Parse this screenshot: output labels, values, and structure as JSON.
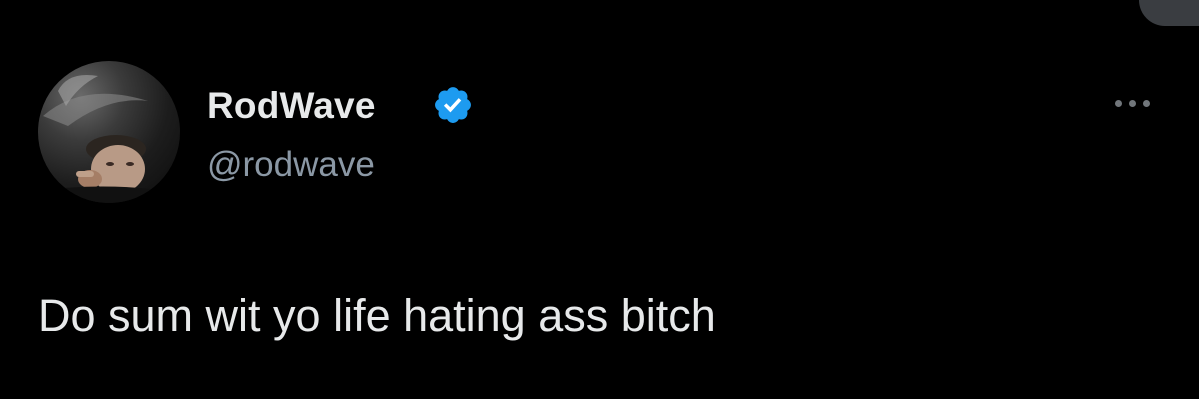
{
  "tweet": {
    "author": {
      "display_name": "RodWave",
      "handle": "@rodwave",
      "verified": true,
      "avatar_icon": "profile-photo"
    },
    "text": "Do sum wit yo life hating ass bitch",
    "menu_icon": "more-options-icon"
  },
  "colors": {
    "background": "#000000",
    "primary_text": "#e7e9ea",
    "secondary_text": "#8b98a5",
    "verified_blue": "#1d9bf0"
  }
}
